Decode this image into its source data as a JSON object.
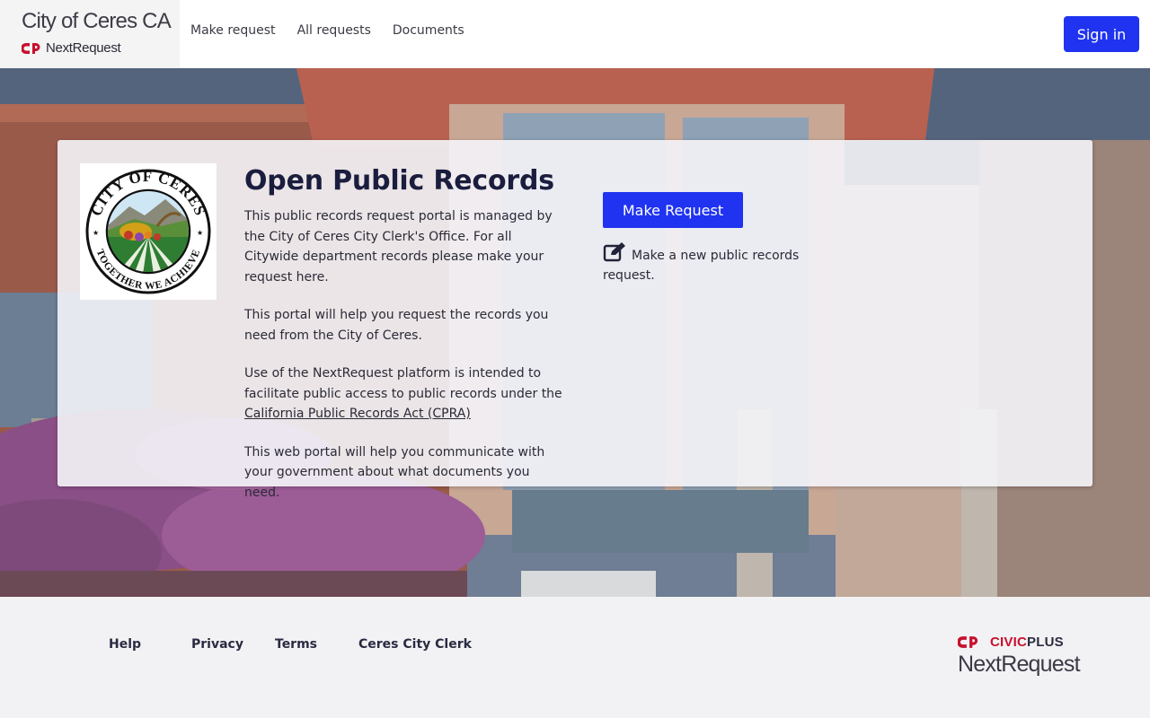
{
  "header": {
    "brand_title": "City of Ceres CA",
    "brand_sub": "NextRequest",
    "nav": [
      {
        "label": "Make request"
      },
      {
        "label": "All requests"
      },
      {
        "label": "Documents"
      }
    ],
    "sign_in_label": "Sign in"
  },
  "card": {
    "seal": {
      "top_text": "CITY OF CERES",
      "bottom_text": "TOGETHER WE ACHIEVE"
    },
    "title": "Open Public Records",
    "paragraphs": [
      "This public records request portal is managed by the City of Ceres City Clerk's Office. For all Citywide department records please make your request here.",
      "This portal will help you request the records you need from the City of Ceres.",
      "Use of the NextRequest platform is intended to facilitate public access to public records under the",
      "This web portal will help you communicate with your government about what documents you need."
    ],
    "cpra_link": "California Public Records Act (CPRA)",
    "make_request_label": "Make Request",
    "make_request_desc": "Make a new public records request.",
    "icons": {
      "make_request": "edit-icon"
    }
  },
  "footer": {
    "links": [
      {
        "label": "Help"
      },
      {
        "label": "Privacy"
      },
      {
        "label": "Terms"
      },
      {
        "label": "Ceres City Clerk"
      }
    ],
    "civicplus_civic": "CIVIC",
    "civicplus_plus": "PLUS",
    "civicplus_product": "NextRequest"
  },
  "colors": {
    "primary_button": "#1f33f0",
    "civicplus_red": "#c8102e",
    "title_navy": "#1b1d3e"
  }
}
